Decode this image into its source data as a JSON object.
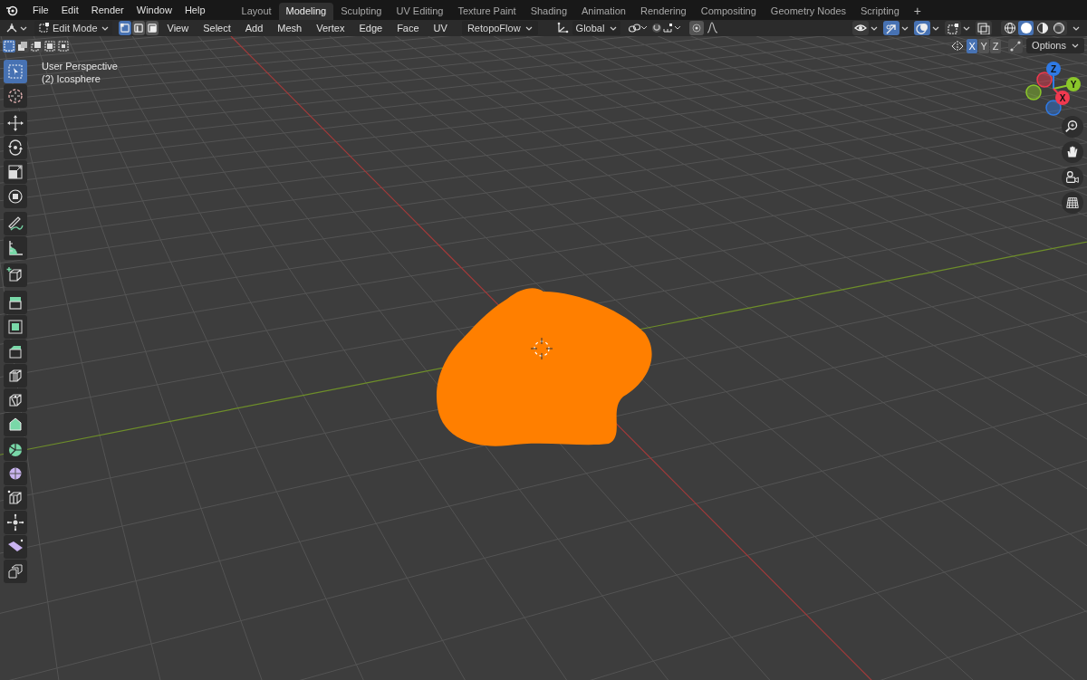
{
  "menu": [
    "File",
    "Edit",
    "Render",
    "Window",
    "Help"
  ],
  "workspaces": [
    {
      "label": "Layout",
      "selected": false
    },
    {
      "label": "Modeling",
      "selected": true
    },
    {
      "label": "Sculpting",
      "selected": false
    },
    {
      "label": "UV Editing",
      "selected": false
    },
    {
      "label": "Texture Paint",
      "selected": false
    },
    {
      "label": "Shading",
      "selected": false
    },
    {
      "label": "Animation",
      "selected": false
    },
    {
      "label": "Rendering",
      "selected": false
    },
    {
      "label": "Compositing",
      "selected": false
    },
    {
      "label": "Geometry Nodes",
      "selected": false
    },
    {
      "label": "Scripting",
      "selected": false
    }
  ],
  "add_workspace": "+",
  "header": {
    "mode": "Edit Mode",
    "select_modes": [
      {
        "kind": "vertex",
        "selected": true
      },
      {
        "kind": "edge",
        "selected": false
      },
      {
        "kind": "face",
        "selected": false
      }
    ],
    "menus": [
      "View",
      "Select",
      "Add",
      "Mesh",
      "Vertex",
      "Edge",
      "Face",
      "UV"
    ],
    "addon_menu": "RetopoFlow",
    "orientation": "Global",
    "viewport_toggles": [
      {
        "kind": "visibility",
        "on": false
      },
      {
        "kind": "gizmos",
        "on": true
      },
      {
        "kind": "overlays",
        "on": true
      },
      {
        "kind": "mesh-overlays",
        "on": false
      },
      {
        "kind": "xray",
        "on": false
      }
    ],
    "shading_modes": [
      {
        "kind": "wireframe",
        "selected": false
      },
      {
        "kind": "solid",
        "selected": true
      },
      {
        "kind": "material",
        "selected": false
      },
      {
        "kind": "rendered",
        "selected": false
      }
    ]
  },
  "selection_operations": [
    {
      "kind": "new",
      "selected": true
    },
    {
      "kind": "extend",
      "selected": false
    },
    {
      "kind": "subtract",
      "selected": false
    },
    {
      "kind": "invert",
      "selected": false
    },
    {
      "kind": "intersect",
      "selected": false
    }
  ],
  "mirror_axes": [
    {
      "label": "X",
      "selected": true
    },
    {
      "label": "Y",
      "selected": false
    },
    {
      "label": "Z",
      "selected": false
    }
  ],
  "options": "Options",
  "viewport": {
    "view_name": "User Perspective",
    "object_name": "(2) Icosphere"
  },
  "tool_groups": [
    [
      {
        "kind": "select",
        "selected": true
      },
      {
        "kind": "cursor",
        "selected": false
      }
    ],
    [
      {
        "kind": "move",
        "selected": false
      },
      {
        "kind": "rotate",
        "selected": false
      },
      {
        "kind": "scale",
        "selected": false
      },
      {
        "kind": "transform",
        "selected": false
      }
    ],
    [
      {
        "kind": "annotate",
        "selected": false
      },
      {
        "kind": "measure",
        "selected": false
      }
    ],
    [
      {
        "kind": "add_cube",
        "selected": false
      }
    ],
    [
      {
        "kind": "extrude",
        "selected": false
      },
      {
        "kind": "inset",
        "selected": false
      },
      {
        "kind": "bevel",
        "selected": false
      },
      {
        "kind": "loop_cut",
        "selected": false
      },
      {
        "kind": "knife",
        "selected": false
      },
      {
        "kind": "poly_build",
        "selected": false
      },
      {
        "kind": "spin",
        "selected": false
      },
      {
        "kind": "smooth",
        "selected": false
      },
      {
        "kind": "edge_slide",
        "selected": false
      },
      {
        "kind": "shrink",
        "selected": false
      },
      {
        "kind": "shear",
        "selected": false
      },
      {
        "kind": "rip",
        "selected": false
      }
    ]
  ],
  "navigation_gizmo": [
    {
      "label": "Z",
      "color": "#2f7ae5"
    },
    {
      "label": "Y",
      "color": "#8bc72a"
    },
    {
      "label": "X",
      "color": "#f0394f"
    }
  ],
  "navigation_buttons": [
    {
      "kind": "zoom"
    },
    {
      "kind": "pan"
    },
    {
      "kind": "camera"
    },
    {
      "kind": "perspective"
    }
  ]
}
